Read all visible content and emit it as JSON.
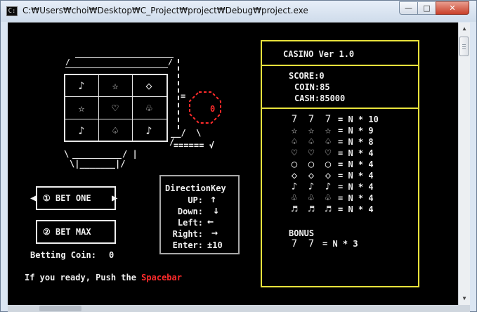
{
  "window": {
    "title": "C:₩Users₩choi₩Desktop₩C_Project₩project₩Debug₩project.exe",
    "controls": {
      "minimize": "—",
      "maximize": "□",
      "close": "✕"
    }
  },
  "slot": {
    "grid": [
      [
        "♪",
        "☆",
        "◇"
      ],
      [
        "☆",
        "♡",
        "♧"
      ],
      [
        "♪",
        "♤",
        "♪"
      ]
    ],
    "counter": "0",
    "lever_line": "====== √"
  },
  "buttons": {
    "bet_one": "① BET ONE",
    "bet_max": "② BET MAX"
  },
  "betting": {
    "label": "Betting Coin:",
    "value": "0"
  },
  "direction": {
    "title": "DirectionKey",
    "rows": [
      {
        "key": "UP:",
        "val": "↑"
      },
      {
        "key": "Down:",
        "val": "↓"
      },
      {
        "key": "Left:",
        "val": "←"
      },
      {
        "key": "Right:",
        "val": "→"
      },
      {
        "key": "Enter:",
        "val": "±10"
      }
    ]
  },
  "prompt": {
    "text": "If you ready, Push the ",
    "highlight": "Spacebar",
    "highlight_color": "#ff2b2b"
  },
  "casino": {
    "title": "CASINO Ver 1.0",
    "score_label": "SCORE:",
    "score": "0",
    "coin_label": "COIN:",
    "coin": "85",
    "cash_label": "CASH:",
    "cash": "85000",
    "paytable": [
      {
        "sym": "7",
        "mult": "= N * 10"
      },
      {
        "sym": "☆",
        "mult": "= N * 9"
      },
      {
        "sym": "♤",
        "mult": "= N * 8"
      },
      {
        "sym": "♡",
        "mult": "= N * 4"
      },
      {
        "sym": "○",
        "mult": "= N * 4"
      },
      {
        "sym": "◇",
        "mult": "= N * 4"
      },
      {
        "sym": "♪",
        "mult": "= N * 4"
      },
      {
        "sym": "♧",
        "mult": "= N * 4"
      },
      {
        "sym": "♬",
        "mult": "= N * 4"
      }
    ],
    "bonus_label": "BONUS",
    "bonus_sym": "7",
    "bonus_mult": "= N * 3"
  },
  "colors": {
    "console_bg": "#000000",
    "yellow": "#e8e23c",
    "red": "#ff2b2b",
    "text": "#f0f0f0"
  }
}
